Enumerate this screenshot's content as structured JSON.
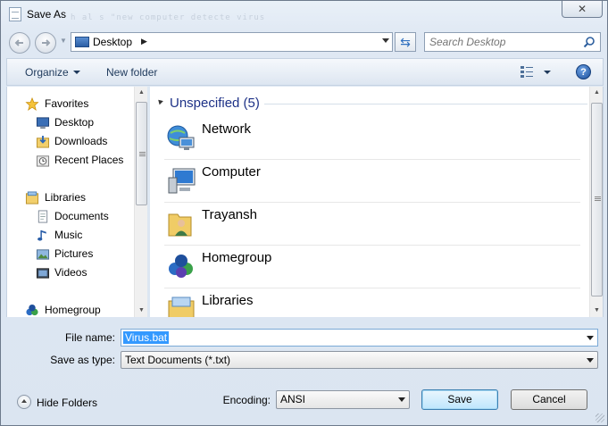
{
  "window": {
    "title": "Save As",
    "watermark": "h  al  s  \"new  computer  detecte  virus"
  },
  "address": {
    "location": "Desktop",
    "search_placeholder": "Search Desktop"
  },
  "toolbar": {
    "organize_label": "Organize",
    "new_folder_label": "New folder",
    "help_label": "?"
  },
  "navpane": {
    "items": [
      {
        "label": "Favorites",
        "icon": "star-icon"
      },
      {
        "label": "Desktop",
        "icon": "desktop-icon"
      },
      {
        "label": "Downloads",
        "icon": "downloads-icon"
      },
      {
        "label": "Recent Places",
        "icon": "recent-places-icon"
      },
      {
        "label": "Libraries",
        "icon": "libraries-icon"
      },
      {
        "label": "Documents",
        "icon": "documents-icon"
      },
      {
        "label": "Music",
        "icon": "music-icon"
      },
      {
        "label": "Pictures",
        "icon": "pictures-icon"
      },
      {
        "label": "Videos",
        "icon": "videos-icon"
      },
      {
        "label": "Homegroup",
        "icon": "homegroup-icon"
      }
    ]
  },
  "main": {
    "group_title": "Unspecified (5)",
    "items": [
      {
        "label": "Network",
        "icon": "network-icon"
      },
      {
        "label": "Computer",
        "icon": "computer-icon"
      },
      {
        "label": "Trayansh",
        "icon": "user-folder-icon"
      },
      {
        "label": "Homegroup",
        "icon": "homegroup-icon"
      },
      {
        "label": "Libraries",
        "icon": "libraries-icon"
      }
    ]
  },
  "form": {
    "file_name_label": "File name:",
    "file_name_value": "Virus.bat",
    "save_type_label": "Save as type:",
    "save_type_value": "Text Documents (*.txt)",
    "encoding_label": "Encoding:",
    "encoding_value": "ANSI"
  },
  "footer": {
    "hide_folders_label": "Hide Folders",
    "save_label": "Save",
    "cancel_label": "Cancel"
  },
  "colors": {
    "group_title": "#1e3287",
    "selection": "#3399ff",
    "toolbar_text": "#1e395b"
  }
}
